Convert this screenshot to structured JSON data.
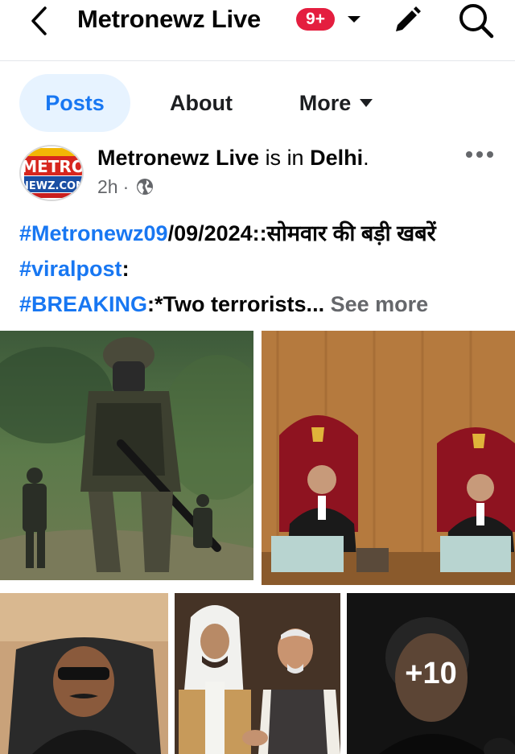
{
  "header": {
    "page_name": "Metronewz Live",
    "notification_badge": "9+",
    "icons": {
      "back": "chevron-left-icon",
      "dropdown": "caret-down-icon",
      "edit": "pencil-icon",
      "search": "search-icon"
    }
  },
  "tabs": [
    {
      "label": "Posts",
      "active": true
    },
    {
      "label": "About",
      "active": false
    },
    {
      "label": "More",
      "active": false
    }
  ],
  "post": {
    "author": "Metronewz Live",
    "is_in": "is in",
    "location": "Delhi",
    "location_suffix": ".",
    "time": "2h",
    "meta_separator": "·",
    "audience_icon": "globe-icon",
    "avatar_logo_text": "METRO",
    "avatar_logo_subtext": "NEWZ.COM",
    "text": {
      "hashtag1": "#Metronewz09",
      "date_text": "/09/2024::सोमवार की  बड़ी खबरें ",
      "hashtag2": "#viralpost",
      "colon": ":",
      "hashtag3": "#BREAKING",
      "body": ":*Two terrorists...",
      "see_more": "See more"
    },
    "photos": [
      {
        "name": "soldier-photo"
      },
      {
        "name": "court-photo"
      },
      {
        "name": "man-in-chair-photo"
      },
      {
        "name": "handshake-photo"
      },
      {
        "name": "portrait-photo",
        "more_count": "+10"
      }
    ]
  },
  "colors": {
    "accent": "#1877f2",
    "badge": "#e41e3f",
    "muted": "#65676b",
    "active_tab_bg": "#e7f3ff"
  }
}
